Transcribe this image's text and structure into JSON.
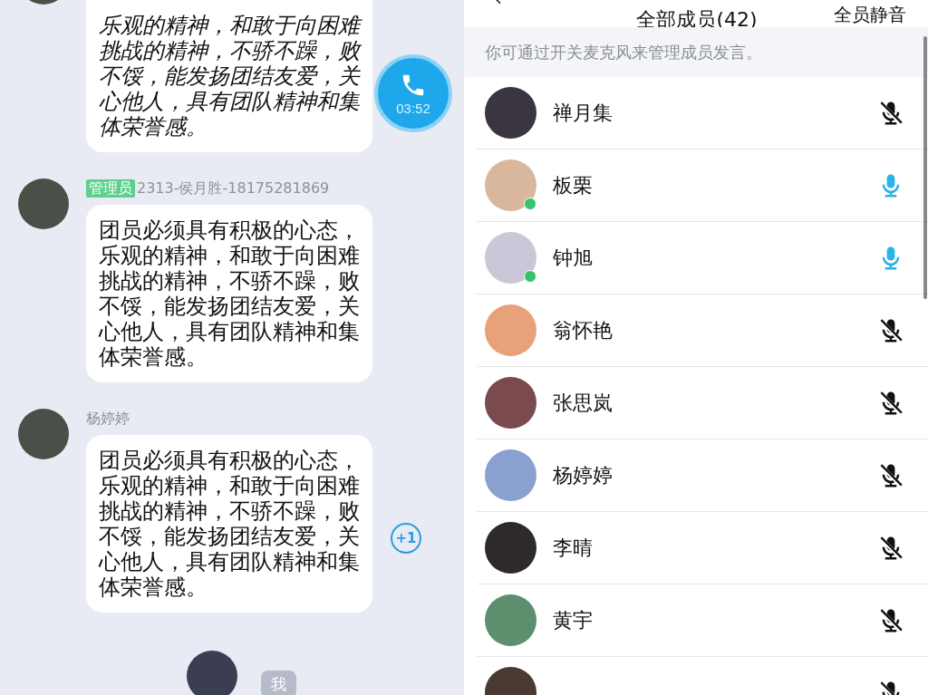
{
  "chat": {
    "messages": [
      {
        "kind": "handwriting",
        "text": "乐观的精神，和敢于向困难挑战的精神，不骄不躁，败不馁，能发扬团结友爱，关心他人，具有团队精神和集体荣誉感。"
      },
      {
        "kind": "text",
        "admin_badge": "管理员",
        "sender": "2313-侯月胜-18175281869",
        "text": "团员必须具有积极的心态，乐观的精神，和敢于向困难挑战的精神，不骄不躁，败不馁，能发扬团结友爱，关心他人，具有团队精神和集体荣誉感。"
      },
      {
        "kind": "text",
        "sender": "杨婷婷",
        "text": "团员必须具有积极的心态，乐观的精神，和敢于向困难挑战的精神，不骄不躁，败不馁，能发扬团结友爱，关心他人，具有团队精神和集体荣誉感。",
        "plus_one": "+1"
      }
    ],
    "call_button": {
      "time": "03:52"
    },
    "me_label": "我"
  },
  "members_panel": {
    "title": "全部成员(42)",
    "action": "全员静音",
    "notice": "你可通过开关麦克风来管理成员发言。",
    "members": [
      {
        "name": "禅月集",
        "muted": true,
        "online": false,
        "color": "#3a3540"
      },
      {
        "name": "板栗",
        "muted": false,
        "online": true,
        "color": "#d9b79c"
      },
      {
        "name": "钟旭",
        "muted": false,
        "online": true,
        "color": "#c9c7d8"
      },
      {
        "name": "翁怀艳",
        "muted": true,
        "online": false,
        "color": "#e8a27a"
      },
      {
        "name": "张思岚",
        "muted": true,
        "online": false,
        "color": "#7a4a4e"
      },
      {
        "name": "杨婷婷",
        "muted": true,
        "online": false,
        "color": "#8aa0d0"
      },
      {
        "name": "李晴",
        "muted": true,
        "online": false,
        "color": "#2e2a2a"
      },
      {
        "name": "黄宇",
        "muted": true,
        "online": false,
        "color": "#5b8f6e"
      },
      {
        "muted": true,
        "online": false,
        "color": "#4a3a34"
      }
    ]
  }
}
